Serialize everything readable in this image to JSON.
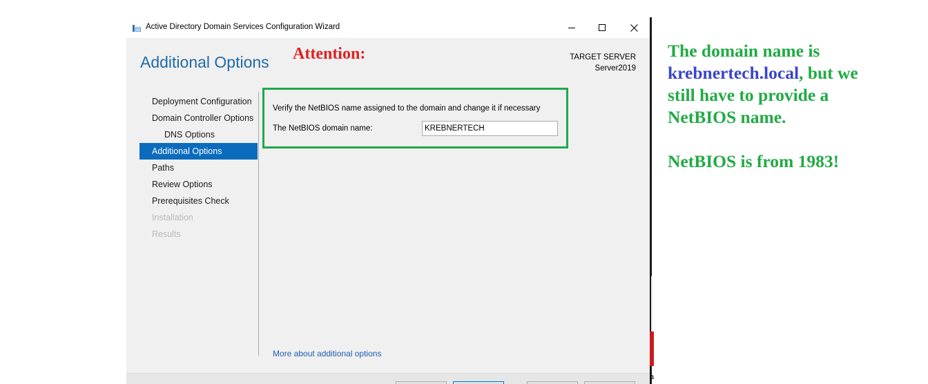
{
  "window": {
    "title": "Active Directory Domain Services Configuration Wizard",
    "controls": {
      "minimize_icon": "minimize-icon",
      "maximize_icon": "maximize-icon",
      "close_icon": "close-icon"
    }
  },
  "page": {
    "title": "Additional Options",
    "target_label": "TARGET SERVER",
    "target_server": "Server2019"
  },
  "overlay": {
    "attention": "Attention:"
  },
  "nav": {
    "items": [
      {
        "label": "Deployment Configuration",
        "state": "normal"
      },
      {
        "label": "Domain Controller Options",
        "state": "normal"
      },
      {
        "label": "DNS Options",
        "state": "sub"
      },
      {
        "label": "Additional Options",
        "state": "selected"
      },
      {
        "label": "Paths",
        "state": "normal"
      },
      {
        "label": "Review Options",
        "state": "normal"
      },
      {
        "label": "Prerequisites Check",
        "state": "normal"
      },
      {
        "label": "Installation",
        "state": "disabled"
      },
      {
        "label": "Results",
        "state": "disabled"
      }
    ]
  },
  "main": {
    "verify_text": "Verify the NetBIOS name assigned to the domain and change it if necessary",
    "netbios_label": "The NetBIOS domain name:",
    "netbios_value": "KREBNERTECH",
    "more_link": "More about additional options"
  },
  "annotation": {
    "line1_prefix": "The domain name is",
    "domain": "krebnertech.local",
    "line2_suffix": ", but we",
    "line3": "still have to provide a",
    "line4": "NetBIOS name.",
    "line5": "NetBIOS is from 1983!"
  },
  "colors": {
    "accent": "#0b6cbd",
    "title_blue": "#1e6aa8",
    "highlight_green": "#1fa84a",
    "attention_red": "#e02020",
    "annotation_green": "#22aa44",
    "annotation_blue": "#3b45c8"
  },
  "background": {
    "fragment_char": "a"
  }
}
